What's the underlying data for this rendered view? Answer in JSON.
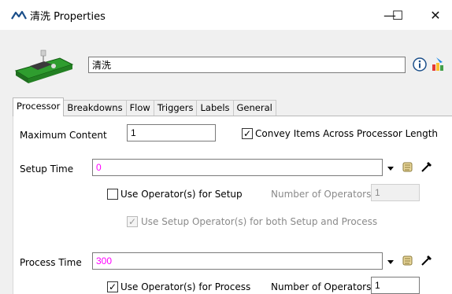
{
  "window": {
    "title_name": "清洗",
    "title_suffix": "Properties",
    "minimize_glyph": "—",
    "maximize_glyph": "☐",
    "close_glyph": "✕"
  },
  "header": {
    "object_name": "清洗",
    "icons": [
      "conveyor-processor-icon",
      "info-icon",
      "paint-icon"
    ]
  },
  "tabs": [
    "Processor",
    "Breakdowns",
    "Flow",
    "Triggers",
    "Labels",
    "General"
  ],
  "active_tab": "Processor",
  "processor": {
    "max_content_label": "Maximum Content",
    "max_content_value": "1",
    "convey_items_label": "Convey Items Across Processor Length",
    "convey_items_checked": true,
    "setup_time_label": "Setup Time",
    "setup_time_value": "0",
    "use_operators_setup_label": "Use Operator(s) for Setup",
    "use_operators_setup_checked": false,
    "num_operators_setup_label": "Number of Operators",
    "num_operators_setup_value": "1",
    "use_setup_operators_both_label": "Use Setup Operator(s) for both Setup and Process",
    "use_setup_operators_both_checked": true,
    "process_time_label": "Process Time",
    "process_time_value": "300",
    "use_operators_process_label": "Use Operator(s) for Process",
    "use_operators_process_checked": true,
    "num_operators_process_label": "Number of Operators",
    "num_operators_process_value": "1"
  },
  "colors": {
    "code_text": "#ff00ff",
    "panel_bg": "#f0f0f0"
  }
}
